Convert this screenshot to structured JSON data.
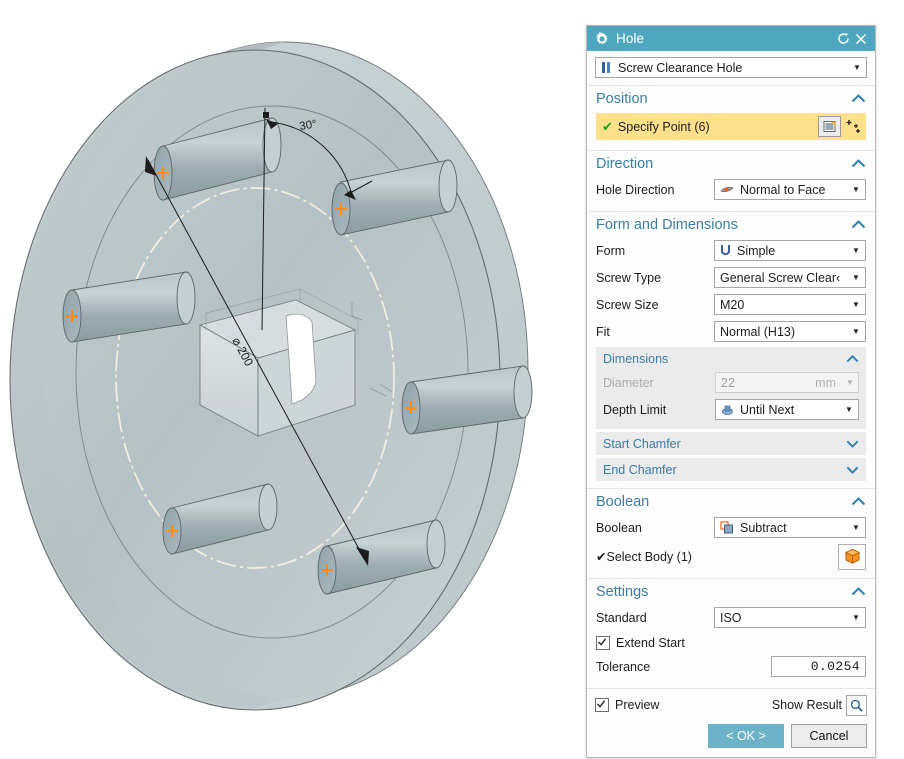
{
  "viewport": {
    "name": "3d-graphics-window",
    "background": "#ffffff",
    "annotations": {
      "angle_dimension": "30°",
      "diameter_dimension": "⌀ 200"
    },
    "model": {
      "description": "Circular flange plate with rectangular central boss and 6 preview hole cylinders on a bolt circle",
      "hole_preview_count": 6,
      "face_color": "#b9c3c6",
      "cylinder_color": "#9fb2b7",
      "point_marker_color": "#ff8c1a",
      "edge_color": "#5d6668",
      "centerline_color": "#f3eddc"
    }
  },
  "dialog": {
    "title": "Hole",
    "title_icon": "gear-icon",
    "reset_icon": "reset-icon",
    "close_icon": "close-icon",
    "accent_color": "#4fa6bf",
    "type": {
      "label": "Screw Clearance Hole",
      "icon": "hole-type-icon"
    },
    "sections": {
      "position": {
        "title": "Position",
        "expanded": true,
        "specify_point": {
          "label": "Specify Point (6)",
          "status_icon": "green-check-icon",
          "highlight_color": "#ffe08c",
          "point_dialog_icon": "point-dialog-icon",
          "point_pattern_icon": "point-pattern-icon"
        }
      },
      "direction": {
        "title": "Direction",
        "expanded": true,
        "hole_direction": {
          "label": "Hole Direction",
          "value": "Normal to Face",
          "icon": "normal-to-face-icon"
        }
      },
      "form_and_dimensions": {
        "title": "Form and Dimensions",
        "expanded": true,
        "form": {
          "label": "Form",
          "value": "Simple",
          "icon": "simple-form-icon"
        },
        "screw_type": {
          "label": "Screw Type",
          "value": "General Screw Clear‹"
        },
        "screw_size": {
          "label": "Screw Size",
          "value": "M20"
        },
        "fit": {
          "label": "Fit",
          "value": "Normal (H13)"
        },
        "dimensions": {
          "title": "Dimensions",
          "expanded": true,
          "diameter": {
            "label": "Diameter",
            "value": "22",
            "unit": "mm",
            "disabled": true
          },
          "depth_limit": {
            "label": "Depth Limit",
            "value": "Until Next",
            "icon": "until-next-icon"
          }
        },
        "start_chamfer": {
          "title": "Start Chamfer",
          "expanded": false
        },
        "end_chamfer": {
          "title": "End Chamfer",
          "expanded": false
        }
      },
      "boolean": {
        "title": "Boolean",
        "expanded": true,
        "boolean": {
          "label": "Boolean",
          "value": "Subtract",
          "icon": "subtract-icon"
        },
        "select_body": {
          "label": "Select Body (1)",
          "status_icon": "green-check-icon",
          "body_icon": "solid-body-icon"
        }
      },
      "settings": {
        "title": "Settings",
        "expanded": true,
        "standard": {
          "label": "Standard",
          "value": "ISO"
        },
        "extend_start": {
          "label": "Extend Start",
          "checked": true
        },
        "tolerance": {
          "label": "Tolerance",
          "value": "0.0254"
        }
      }
    },
    "footer": {
      "preview": {
        "label": "Preview",
        "checked": true
      },
      "show_result": {
        "label": "Show Result",
        "icon": "magnifier-icon"
      },
      "ok": "< OK >",
      "cancel": "Cancel"
    }
  }
}
